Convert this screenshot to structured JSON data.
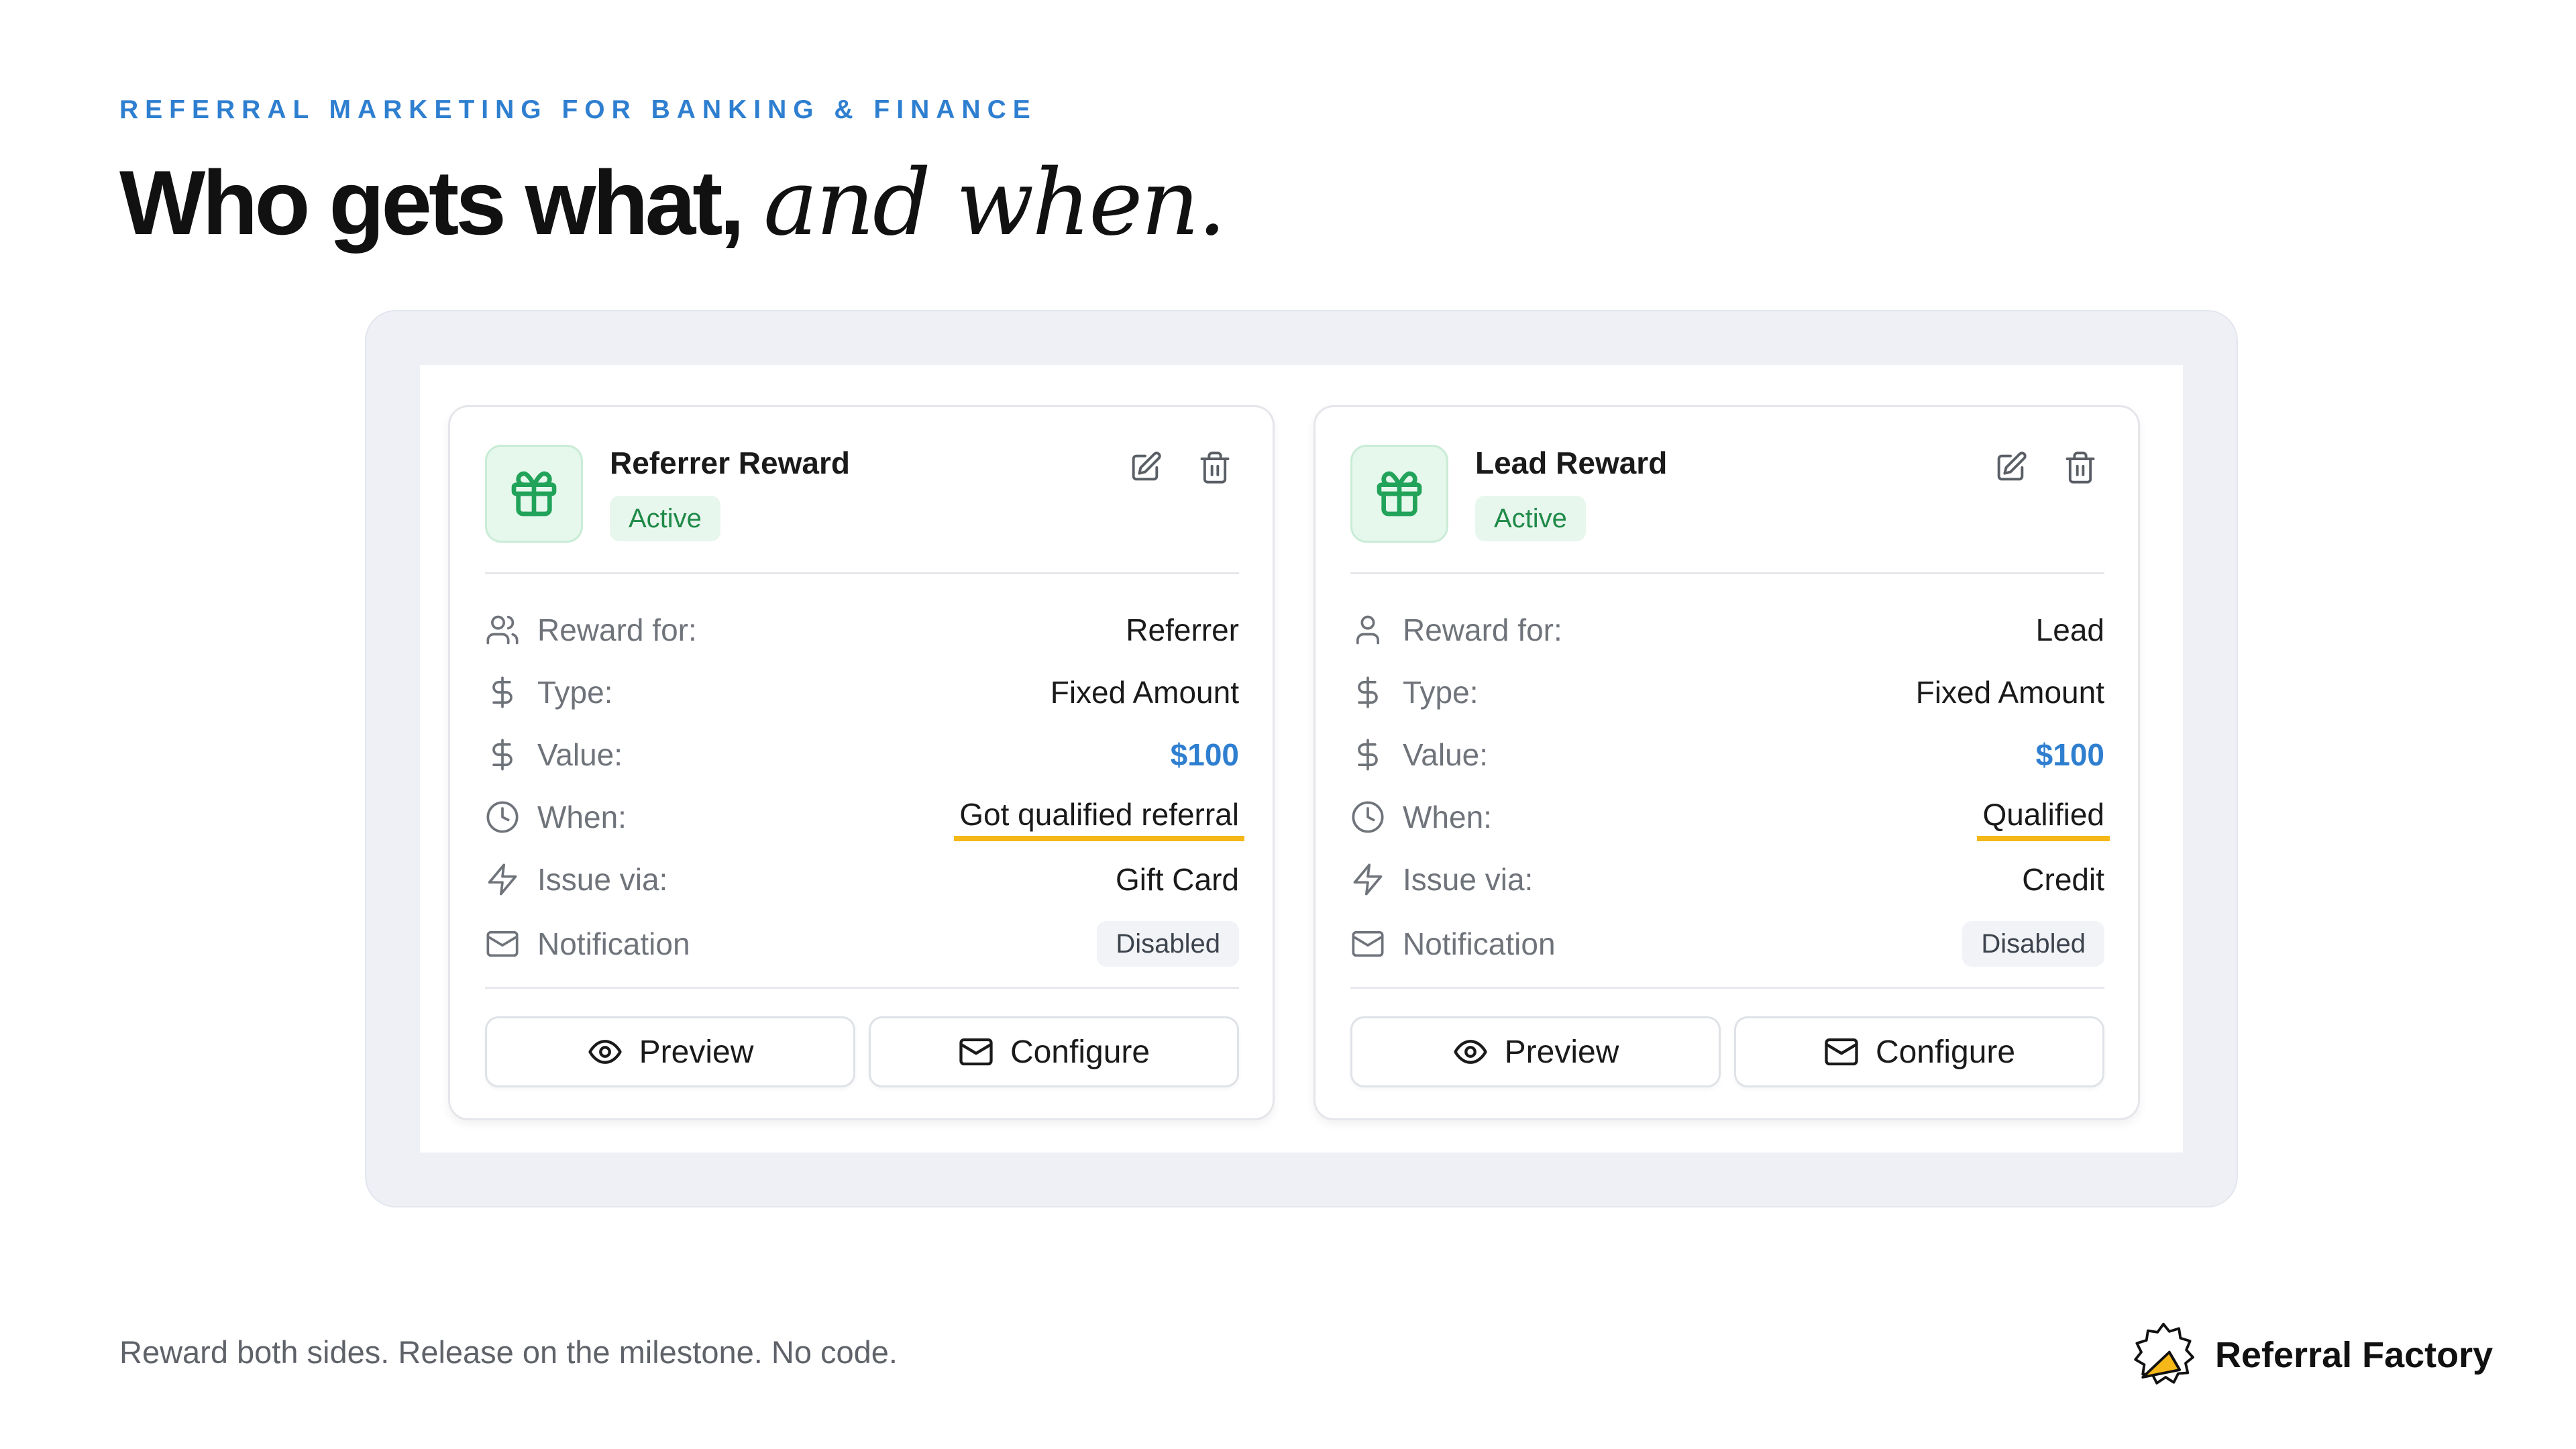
{
  "eyebrow": "REFERRAL MARKETING FOR BANKING & FINANCE",
  "headline": {
    "strong": "Who gets what,",
    "italic": "and when."
  },
  "cards": [
    {
      "title": "Referrer Reward",
      "status": "Active",
      "icon": "gift-icon",
      "rows": [
        {
          "icon": "users-icon",
          "label": "Reward for:",
          "value": "Referrer"
        },
        {
          "icon": "dollar-icon",
          "label": "Type:",
          "value": "Fixed Amount"
        },
        {
          "icon": "dollar-icon",
          "label": "Value:",
          "value": "$100"
        },
        {
          "icon": "clock-icon",
          "label": "When:",
          "value": "Got qualified referral"
        },
        {
          "icon": "lightning-icon",
          "label": "Issue via:",
          "value": "Gift Card"
        },
        {
          "icon": "mail-icon",
          "label": "Notification",
          "value": "Disabled"
        }
      ],
      "buttons": {
        "preview": "Preview",
        "configure": "Configure"
      }
    },
    {
      "title": "Lead Reward",
      "status": "Active",
      "icon": "gift-icon",
      "rows": [
        {
          "icon": "user-icon",
          "label": "Reward for:",
          "value": "Lead"
        },
        {
          "icon": "dollar-icon",
          "label": "Type:",
          "value": "Fixed Amount"
        },
        {
          "icon": "dollar-icon",
          "label": "Value:",
          "value": "$100"
        },
        {
          "icon": "clock-icon",
          "label": "When:",
          "value": "Qualified"
        },
        {
          "icon": "lightning-icon",
          "label": "Issue via:",
          "value": "Credit"
        },
        {
          "icon": "mail-icon",
          "label": "Notification",
          "value": "Disabled"
        }
      ],
      "buttons": {
        "preview": "Preview",
        "configure": "Configure"
      }
    }
  ],
  "footer": {
    "tagline": "Reward both sides. Release on the milestone. No code.",
    "brand": "Referral Factory"
  },
  "colors": {
    "accent": "#2f7fd0",
    "active": "#1f8a48",
    "highlight": "#f5b818"
  }
}
